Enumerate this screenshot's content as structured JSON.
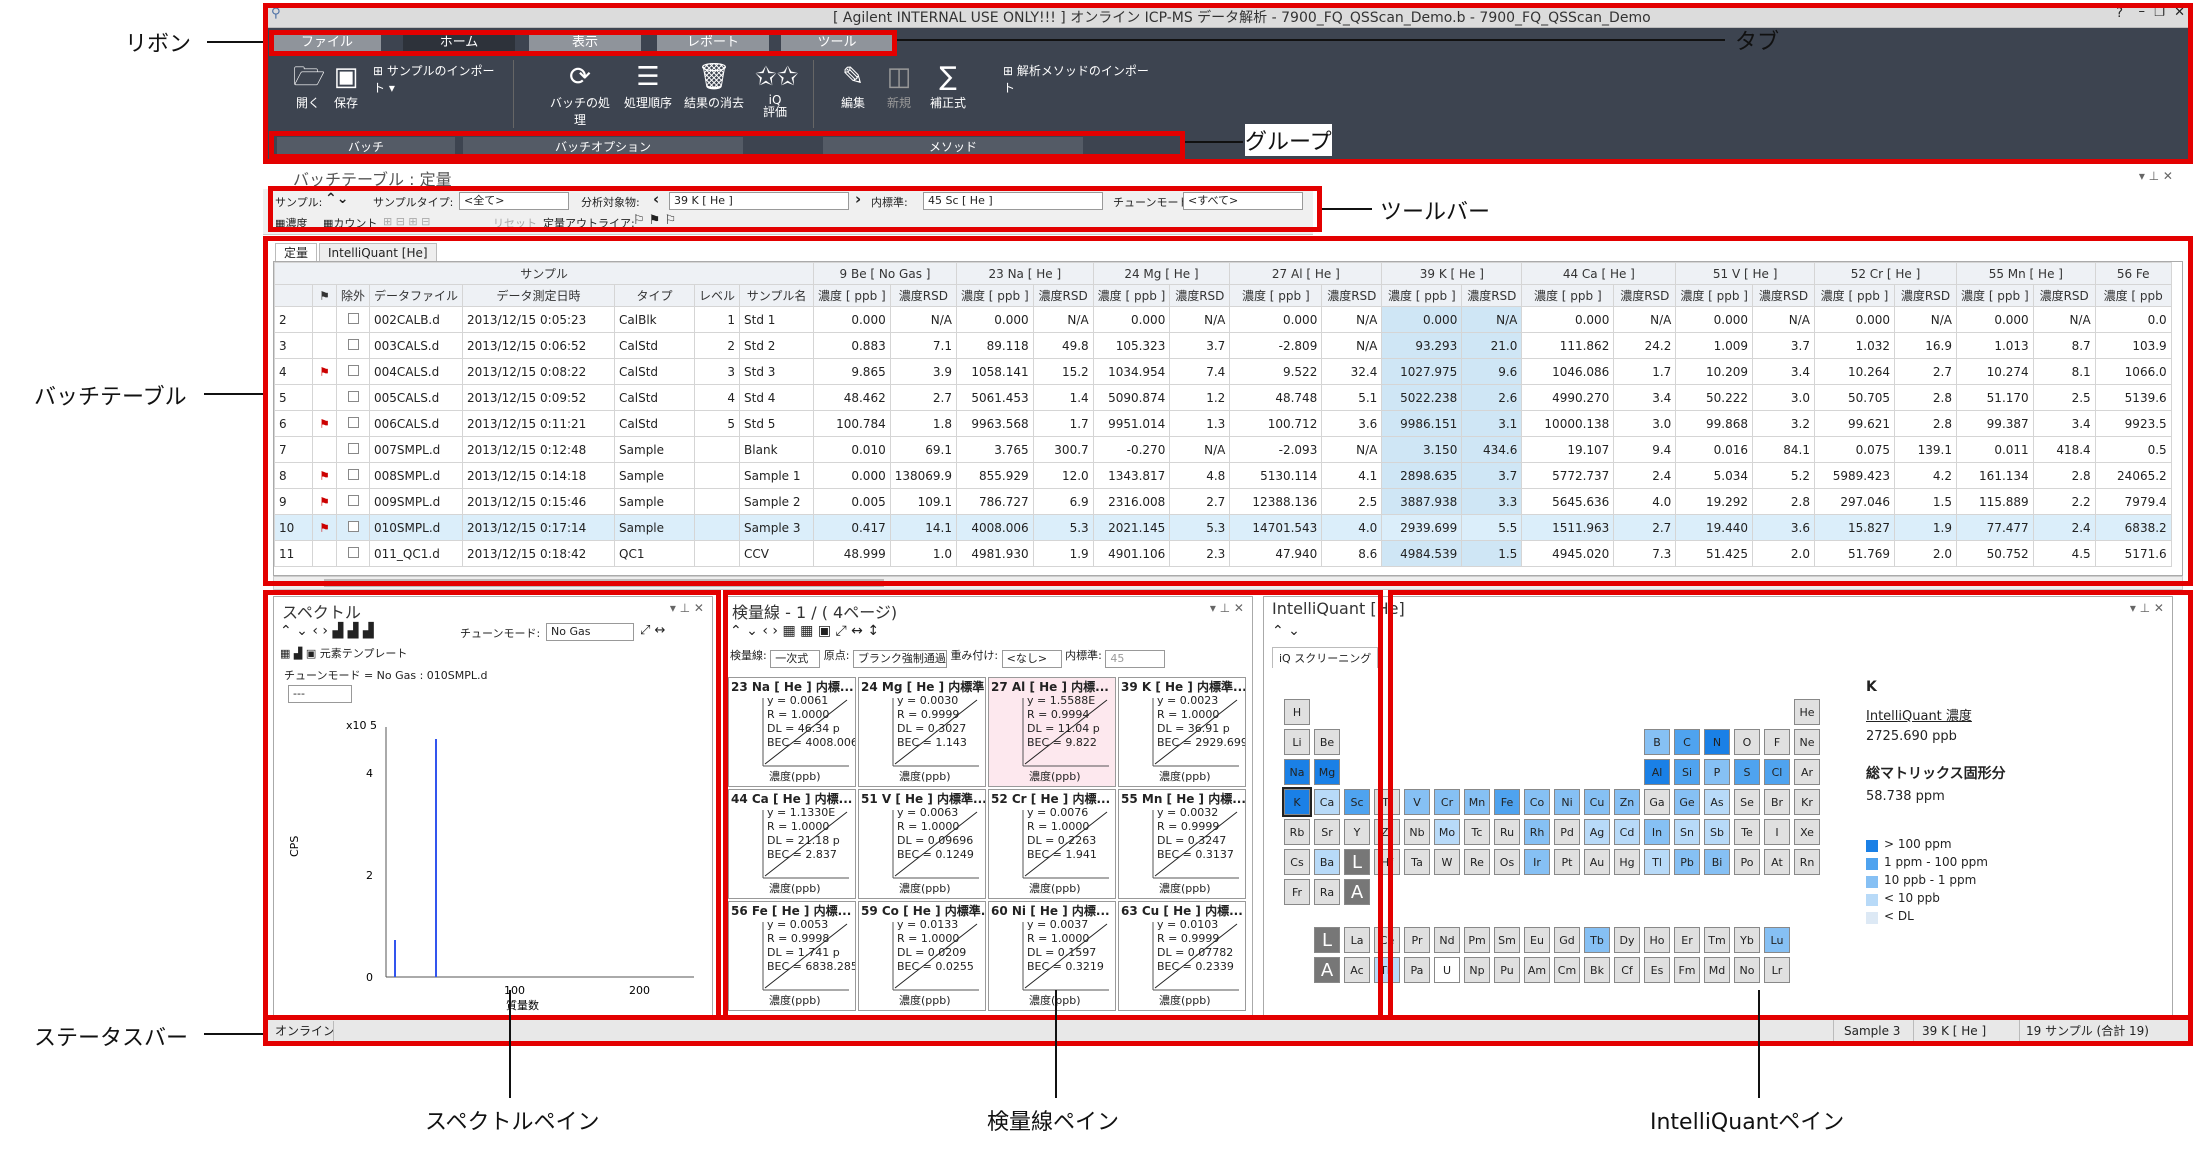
{
  "window": {
    "title": "[ Agilent INTERNAL USE ONLY!!! ] オンライン ICP-MS データ解析 - 7900_FQ_QSScan_Demo.b - 7900_FQ_QSScan_Demo"
  },
  "tabs": [
    "ファイル",
    "ホーム",
    "表示",
    "レポート",
    "ツール"
  ],
  "ribbon": {
    "open": "開く",
    "save": "保存",
    "import_sample": "サンプルのインポート",
    "batch_process": "バッチの処理",
    "process_order": "処理順序",
    "clear_results": "結果の消去",
    "iq_eval": "iQ\n評価",
    "edit": "編集",
    "new": "新規",
    "correction": "補正式",
    "import_method": "解析メソッドのインポート",
    "groups": [
      "バッチ",
      "バッチオプション",
      "メソッド"
    ]
  },
  "batch_table": {
    "title": "バッチテーブル : 定量",
    "toolbar": {
      "sample_label": "サンプル:",
      "sample_type_label": "サンプルタイプ:",
      "sample_type_value": "<全て>",
      "analyte_label": "分析対象物:",
      "analyte_value": "39  K  [ He ]",
      "istd_label": "内標準:",
      "istd_value": "45  Sc  [ He ]",
      "tune_label": "チューンモード:",
      "tune_value": "<すべて>",
      "conc_label": "濃度",
      "count_label": "カウント",
      "reset_label": "リセット",
      "outlier_label": "定量アウトライア:"
    },
    "tabs": [
      "定量",
      "IntelliQuant [He]"
    ],
    "sample_header": "サンプル",
    "columns": [
      "除外",
      "データファイル",
      "データ測定日時",
      "タイプ",
      "レベル",
      "サンプル名"
    ],
    "elements": [
      "9  Be  [ No Gas ]",
      "23  Na  [ He ]",
      "24  Mg  [ He ]",
      "27  Al  [ He ]",
      "39  K  [ He ]",
      "44  Ca  [ He ]",
      "51  V  [ He ]",
      "52  Cr  [ He ]",
      "55  Mn  [ He ]",
      "56  Fe"
    ],
    "conc_col": "濃度 [ ppb ]",
    "rsd_col": "濃度RSD",
    "conc_col_short": "濃度 [ ppb",
    "rows": [
      {
        "n": "2",
        "flag": "",
        "file": "002CALB.d",
        "date": "2013/12/15 0:05:23",
        "type": "CalBlk",
        "level": "1",
        "name": "Std 1",
        "v": [
          "0.000",
          "N/A",
          "0.000",
          "N/A",
          "0.000",
          "N/A",
          "0.000",
          "N/A",
          "0.000",
          "N/A",
          "0.000",
          "N/A",
          "0.000",
          "N/A",
          "0.000",
          "N/A",
          "0.000",
          "N/A",
          "0.0"
        ]
      },
      {
        "n": "3",
        "flag": "",
        "file": "003CALS.d",
        "date": "2013/12/15 0:06:52",
        "type": "CalStd",
        "level": "2",
        "name": "Std 2",
        "v": [
          "0.883",
          "7.1",
          "89.118",
          "49.8",
          "105.323",
          "3.7",
          "-2.809",
          "N/A",
          "93.293",
          "21.0",
          "111.862",
          "24.2",
          "1.009",
          "3.7",
          "1.032",
          "16.9",
          "1.013",
          "8.7",
          "103.9"
        ]
      },
      {
        "n": "4",
        "flag": "⚑",
        "file": "004CALS.d",
        "date": "2013/12/15 0:08:22",
        "type": "CalStd",
        "level": "3",
        "name": "Std 3",
        "v": [
          "9.865",
          "3.9",
          "1058.141",
          "15.2",
          "1034.954",
          "7.4",
          "9.522",
          "32.4",
          "1027.975",
          "9.6",
          "1046.086",
          "1.7",
          "10.209",
          "3.4",
          "10.264",
          "2.7",
          "10.274",
          "8.1",
          "1066.0"
        ]
      },
      {
        "n": "5",
        "flag": "",
        "file": "005CALS.d",
        "date": "2013/12/15 0:09:52",
        "type": "CalStd",
        "level": "4",
        "name": "Std 4",
        "v": [
          "48.462",
          "2.7",
          "5061.453",
          "1.4",
          "5090.874",
          "1.2",
          "48.748",
          "5.1",
          "5022.238",
          "2.6",
          "4990.270",
          "3.4",
          "50.222",
          "3.0",
          "50.705",
          "2.8",
          "51.170",
          "2.5",
          "5139.6"
        ]
      },
      {
        "n": "6",
        "flag": "⚑",
        "file": "006CALS.d",
        "date": "2013/12/15 0:11:21",
        "type": "CalStd",
        "level": "5",
        "name": "Std 5",
        "v": [
          "100.784",
          "1.8",
          "9963.568",
          "1.7",
          "9951.014",
          "1.3",
          "100.712",
          "3.6",
          "9986.151",
          "3.1",
          "10000.138",
          "3.0",
          "99.868",
          "3.2",
          "99.621",
          "2.8",
          "99.387",
          "3.4",
          "9923.5"
        ]
      },
      {
        "n": "7",
        "flag": "",
        "file": "007SMPL.d",
        "date": "2013/12/15 0:12:48",
        "type": "Sample",
        "level": "",
        "name": "Blank",
        "v": [
          "0.010",
          "69.1",
          "3.765",
          "300.7",
          "-0.270",
          "N/A",
          "-2.093",
          "N/A",
          "3.150",
          "434.6",
          "19.107",
          "9.4",
          "0.016",
          "84.1",
          "0.075",
          "139.1",
          "0.011",
          "418.4",
          "0.5"
        ]
      },
      {
        "n": "8",
        "flag": "⚑",
        "file": "008SMPL.d",
        "date": "2013/12/15 0:14:18",
        "type": "Sample",
        "level": "",
        "name": "Sample 1",
        "v": [
          "0.000",
          "138069.9",
          "855.929",
          "12.0",
          "1343.817",
          "4.8",
          "5130.114",
          "4.1",
          "2898.635",
          "3.7",
          "5772.737",
          "2.4",
          "5.034",
          "5.2",
          "5989.423",
          "4.2",
          "161.134",
          "2.8",
          "24065.2"
        ]
      },
      {
        "n": "9",
        "flag": "⚑",
        "file": "009SMPL.d",
        "date": "2013/12/15 0:15:46",
        "type": "Sample",
        "level": "",
        "name": "Sample 2",
        "v": [
          "0.005",
          "109.1",
          "786.727",
          "6.9",
          "2316.008",
          "2.7",
          "12388.136",
          "2.5",
          "3887.938",
          "3.3",
          "5645.636",
          "4.0",
          "19.292",
          "2.8",
          "297.046",
          "1.5",
          "115.889",
          "2.2",
          "7979.4"
        ]
      },
      {
        "n": "10",
        "flag": "⚑",
        "file": "010SMPL.d",
        "date": "2013/12/15 0:17:14",
        "type": "Sample",
        "level": "",
        "name": "Sample 3",
        "v": [
          "0.417",
          "14.1",
          "4008.006",
          "5.3",
          "2021.145",
          "5.3",
          "14701.543",
          "4.0",
          "2939.699",
          "5.5",
          "1511.963",
          "2.7",
          "19.440",
          "3.6",
          "15.827",
          "1.9",
          "77.477",
          "2.4",
          "6838.2"
        ]
      },
      {
        "n": "11",
        "flag": "",
        "file": "011_QC1.d",
        "date": "2013/12/15 0:18:42",
        "type": "QC1",
        "level": "",
        "name": "CCV",
        "v": [
          "48.999",
          "1.0",
          "4981.930",
          "1.9",
          "4901.106",
          "2.3",
          "47.940",
          "8.6",
          "4984.539",
          "1.5",
          "4945.020",
          "7.3",
          "51.425",
          "2.0",
          "51.769",
          "2.0",
          "50.752",
          "4.5",
          "5171.6"
        ]
      }
    ]
  },
  "spectrum": {
    "title": "スペクトル",
    "tune_label": "チューンモード:",
    "tune_value": "No Gas",
    "template": "元素テンプレート",
    "info": "チューンモード = No Gas : 010SMPL.d",
    "select": "---",
    "ylabel": "CPS",
    "xlabel": "質量数",
    "scale": "x10 5",
    "yticks": [
      "4",
      "2",
      "0"
    ],
    "xticks": [
      "100",
      "200"
    ]
  },
  "calibration": {
    "title": "検量線 - 1 / ( 4ページ)",
    "fit_label": "検量線:",
    "fit_value": "一次式",
    "origin_label": "原点:",
    "origin_value": "ブランク強制通過",
    "weight_label": "重み付け:",
    "weight_value": "<なし>",
    "istd_label": "内標準:",
    "istd_value": "45",
    "xlabel": "濃度(ppb)",
    "cells": [
      {
        "h": "23 Na [ He ] 内標...",
        "eq": "y = 0.0061\nR = 1.0000\nDL = 46.34 p\nBEC = 4008.006"
      },
      {
        "h": "24 Mg [ He ] 内標準...",
        "eq": "y = 0.0030\nR = 0.9999\nDL = 0.3027\nBEC = 1.143"
      },
      {
        "h": "27 Al [ He ] 内標...",
        "eq": "y = 1.5588E\nR = 0.9994\nDL = 11.04 p\nBEC = 9.822"
      },
      {
        "h": "39 K [ He ] 内標準...",
        "eq": "y = 0.0023\nR = 1.0000\nDL = 36.91 p\nBEC = 2929.699"
      },
      {
        "h": "44 Ca [ He ] 内標...",
        "eq": "y = 1.1330E\nR = 1.0000\nDL = 21.18 p\nBEC = 2.837"
      },
      {
        "h": "51 V [ He ] 内標準...",
        "eq": "y = 0.0063\nR = 1.0000\nDL = 0.09696\nBEC = 0.1249"
      },
      {
        "h": "52 Cr [ He ] 内標...",
        "eq": "y = 0.0076\nR = 1.0000\nDL = 0.2263\nBEC = 1.941"
      },
      {
        "h": "55 Mn [ He ] 内標...",
        "eq": "y = 0.0032\nR = 0.9999\nDL = 0.3247\nBEC = 0.3137"
      },
      {
        "h": "56 Fe [ He ] 内標...",
        "eq": "y = 0.0053\nR = 0.9998\nDL = 1.741 p\nBEC = 6838.285"
      },
      {
        "h": "59 Co [ He ] 内標準...",
        "eq": "y = 0.0133\nR = 1.0000\nDL = 0.0209\nBEC = 0.0255"
      },
      {
        "h": "60 Ni [ He ] 内標...",
        "eq": "y = 0.0037\nR = 1.0000\nDL = 0.1597\nBEC = 0.3219"
      },
      {
        "h": "63 Cu [ He ] 内標...",
        "eq": "y = 0.0103\nR = 0.9999\nDL = 0.07782\nBEC = 0.2339"
      }
    ]
  },
  "intelliquant": {
    "title": "IntelliQuant [He]",
    "tab": "iQ スクリーニング",
    "element": "K",
    "link": "IntelliQuant 濃度",
    "conc": "2725.690 ppb",
    "tds_label": "総マトリックス固形分",
    "tds": "58.738 ppm",
    "legend": [
      "> 100 ppm",
      "1 ppm - 100 ppm",
      "10 ppb - 1 ppm",
      "< 10 ppb",
      "< DL"
    ],
    "legend_colors": [
      "#1a80e6",
      "#4fa3ef",
      "#86c0f4",
      "#b8daf8",
      "#dde9f5"
    ]
  },
  "statusbar": {
    "left": "オンライン",
    "sample": "Sample 3",
    "analyte": "39  K  [ He ]",
    "count": "19 サンプル (合計 19)"
  },
  "annotations": {
    "ribbon": "リボン",
    "tab": "タブ",
    "group": "グループ",
    "toolbar": "ツールバー",
    "batch_table": "バッチテーブル",
    "statusbar": "ステータスバー",
    "spectrum_pane": "スペクトルペイン",
    "calib_pane": "検量線ペイン",
    "iq_pane": "IntelliQuantペイン"
  }
}
